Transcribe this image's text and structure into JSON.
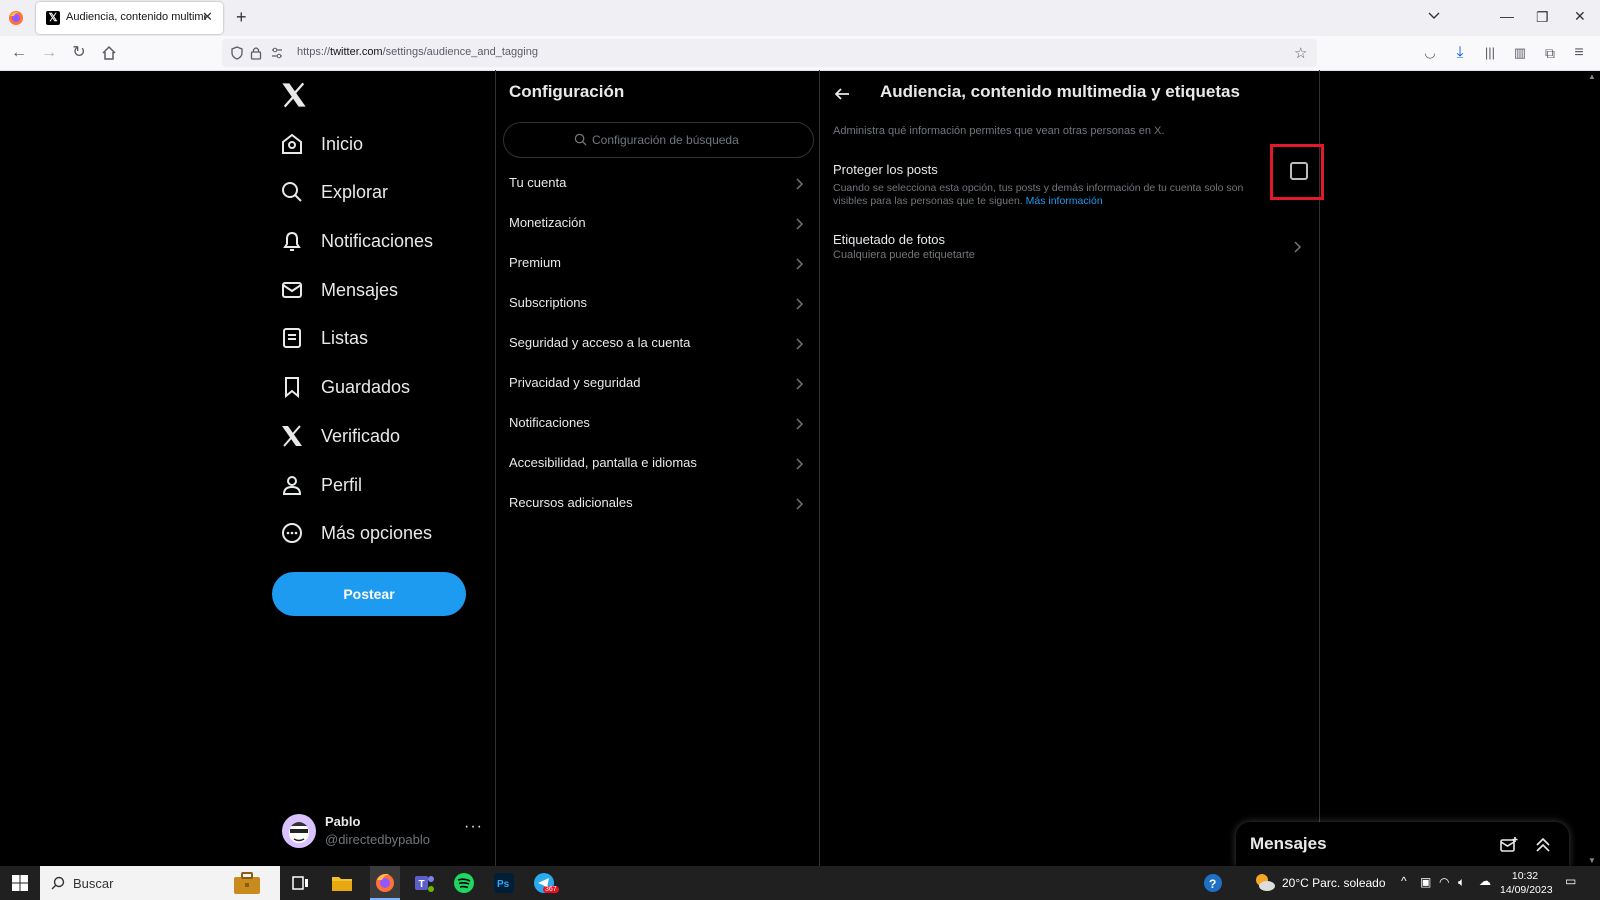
{
  "browser": {
    "tab_title": "Audiencia, contenido multimedia y etiquetas",
    "url_prefix": "https://",
    "url_domain": "twitter.com",
    "url_path": "/settings/audience_and_tagging"
  },
  "nav": {
    "items": [
      {
        "label": "Inicio",
        "icon": "home-icon"
      },
      {
        "label": "Explorar",
        "icon": "search-icon"
      },
      {
        "label": "Notificaciones",
        "icon": "bell-icon"
      },
      {
        "label": "Mensajes",
        "icon": "mail-icon"
      },
      {
        "label": "Listas",
        "icon": "list-icon"
      },
      {
        "label": "Guardados",
        "icon": "bookmark-icon"
      },
      {
        "label": "Verificado",
        "icon": "x-icon"
      },
      {
        "label": "Perfil",
        "icon": "person-icon"
      },
      {
        "label": "Más opciones",
        "icon": "more-circle-icon"
      }
    ],
    "post_label": "Postear"
  },
  "account": {
    "name": "Pablo",
    "handle": "@directedbypablo",
    "more": "···"
  },
  "settings": {
    "title": "Configuración",
    "search_placeholder": "Configuración de búsqueda",
    "items": [
      "Tu cuenta",
      "Monetización",
      "Premium",
      "Subscriptions",
      "Seguridad y acceso a la cuenta",
      "Privacidad y seguridad",
      "Notificaciones",
      "Accesibilidad, pantalla e idiomas",
      "Recursos adicionales"
    ]
  },
  "detail": {
    "title": "Audiencia, contenido multimedia y etiquetas",
    "description": "Administra qué información permites que vean otras personas en X.",
    "protect_title": "Proteger los posts",
    "protect_desc": "Cuando se selecciona esta opción, tus posts y demás información de tu cuenta solo son visibles para las personas que te siguen.",
    "protect_link": "Más información",
    "protect_checked": false,
    "photo_title": "Etiquetado de fotos",
    "photo_sub": "Cualquiera puede etiquetarte"
  },
  "messages_drawer": {
    "title": "Mensajes"
  },
  "taskbar": {
    "search_label": "Buscar",
    "weather": "20°C  Parc. soleado",
    "time": "10:32",
    "date": "14/09/2023",
    "telegram_badge": "367"
  },
  "colors": {
    "accent": "#1d9bf0",
    "highlight": "#e1192b",
    "background": "#000000"
  }
}
